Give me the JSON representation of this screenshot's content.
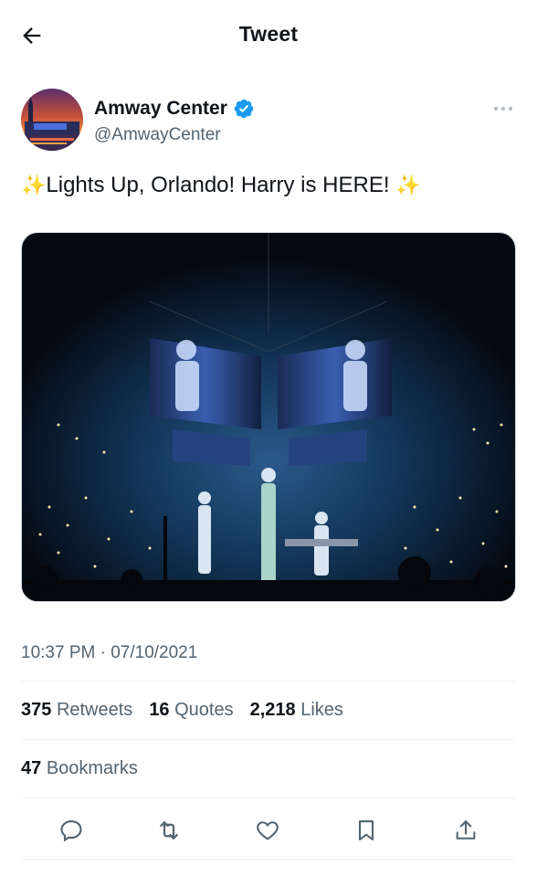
{
  "header": {
    "title": "Tweet"
  },
  "author": {
    "name": "Amway Center",
    "handle": "@AmwayCenter",
    "verified": true
  },
  "tweet": {
    "emoji_left": "✨",
    "text": "Lights Up, Orlando! Harry is HERE! ",
    "emoji_right": "✨"
  },
  "meta": {
    "timestamp": "10:37 PM · 07/10/2021"
  },
  "stats": {
    "retweets_count": "375",
    "retweets_label": "Retweets",
    "quotes_count": "16",
    "quotes_label": "Quotes",
    "likes_count": "2,218",
    "likes_label": "Likes",
    "bookmarks_count": "47",
    "bookmarks_label": "Bookmarks"
  },
  "colors": {
    "text": "#0f1419",
    "secondary": "#536471",
    "verified": "#1d9bf0",
    "divider": "#eff3f4"
  },
  "icons": [
    "back-arrow-icon",
    "verified-badge-icon",
    "more-icon",
    "reply-icon",
    "retweet-icon",
    "like-icon",
    "bookmark-icon",
    "share-icon"
  ]
}
